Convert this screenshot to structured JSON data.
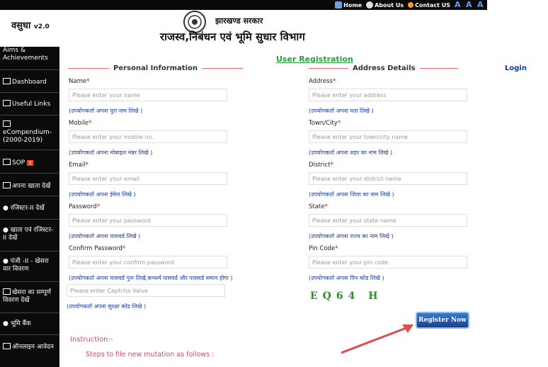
{
  "topbar": {
    "links": [
      "Home",
      "About Us",
      "Contact US"
    ]
  },
  "header": {
    "brand": "वसुधा",
    "version": "v2.0",
    "government": "झारखण्ड सरकार",
    "department": "राजस्व,निबंधन एवं भूमि सुधार विभाग"
  },
  "sidebar": {
    "items": [
      {
        "label": "Aims & Achievements"
      },
      {
        "label": "Dashboard"
      },
      {
        "label": "Useful Links"
      },
      {
        "label": "eCompendium-(2000-2019)"
      },
      {
        "label": "SOP",
        "badge": "3"
      },
      {
        "label": "अपना खाता देखें"
      },
      {
        "label": "रजिस्टर-II देखें"
      },
      {
        "label": "खाता एवं रजिस्टर-II देखें"
      },
      {
        "label": "पंजी -II - खेसरा वार विवरण"
      },
      {
        "label": "खेसरा का सम्पूर्ण विवरण देखें"
      },
      {
        "label": "भूमि बैंक"
      },
      {
        "label": "ऑनलाइन आवेदन"
      }
    ]
  },
  "page": {
    "title": "User Registration",
    "login": "Login"
  },
  "personal": {
    "heading": "Personal Information",
    "fields": [
      {
        "label": "Name",
        "placeholder": "Please enter your name",
        "hint": "(उपयोगकर्ता अपना पूरा नाम लिखे )"
      },
      {
        "label": "Mobile",
        "placeholder": "Please enter your mobile no.",
        "hint": "(उपयोगकर्ता अपना मोबाइल नंबर लिखे )"
      },
      {
        "label": "Email",
        "placeholder": "Please enter your email",
        "hint": "(उपयोगकर्ता अपना ईमेल लिखे )"
      },
      {
        "label": "Password",
        "placeholder": "Please enter your password",
        "hint": "(उपयोगकर्ता अपना पासवर्ड लिखे )"
      },
      {
        "label": "Confirm Password",
        "placeholder": "Please enter your confirm password",
        "hint": "(उपयोगकर्ता अपना पासवर्ड पुनः लिखे,कन्फर्म पासवर्ड और पासवर्ड समान होगा )"
      }
    ],
    "captcha_placeholder": "Please enter Captcha Value",
    "captcha_hint": "(उपयोगकर्ता अपना सुरक्षा कोड लिखे )"
  },
  "address": {
    "heading": "Address Details",
    "fields": [
      {
        "label": "Address",
        "placeholder": "Please enter your address",
        "hint": "(उपयोगकर्ता अपना पता लिखे )"
      },
      {
        "label": "Town/City",
        "placeholder": "Please enter your town/city name",
        "hint": "(उपयोगकर्ता अपना शहर का नाम लिखे )"
      },
      {
        "label": "District",
        "placeholder": "Please enter your district name",
        "hint": "(उपयोगकर्ता अपना जिला का नाम लिखे )"
      },
      {
        "label": "State",
        "placeholder": "Please enter your state name",
        "hint": "(उपयोगकर्ता अपना राज्य का नाम लिखे )"
      },
      {
        "label": "Pin Code",
        "placeholder": "Please enter your pin code",
        "hint": "(उपयोगकर्ता अपना पिन कोड लिखे )"
      }
    ]
  },
  "captcha": "EQ64 H",
  "register_label": "Register Now",
  "instruction": {
    "title": "Instruction:-",
    "steps": "Steps to file new mutation as follows :"
  }
}
